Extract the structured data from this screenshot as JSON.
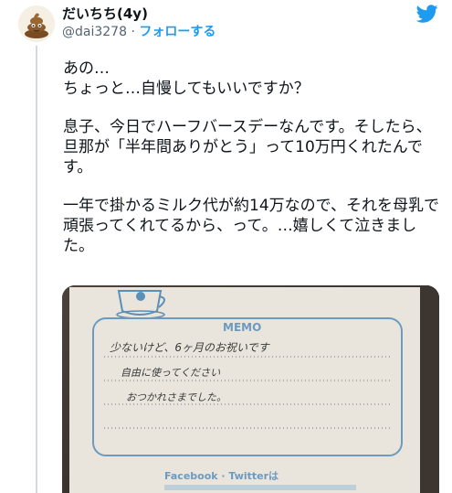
{
  "author": {
    "name": "だいちち(4y)",
    "handle": "@dai3278",
    "separator": "·",
    "follow_label": "フォローする"
  },
  "icons": {
    "avatar": "poop-emoji-avatar",
    "brand": "twitter-bird-icon"
  },
  "colors": {
    "accent": "#1d9bf0",
    "text": "#0f1419",
    "secondary": "#536471"
  },
  "tweet": {
    "paragraphs": [
      "あの…\nちょっと…自慢してもいいですか？",
      "息子、今日でハーフバースデーなんです。そしたら、旦那が「半年間ありがとう」って10万円くれたんです。",
      "一年で掛かるミルク代が約14万なので、それを母乳で頑張ってくれてるから、って。…嬉しくて泣きました。"
    ]
  },
  "photo": {
    "memo_title": "MEMO",
    "handwritten_lines": [
      "少ないけど、6ヶ月のお祝いです",
      "自由に使ってください",
      "おつかれさまでした。"
    ],
    "footer": "Facebook · Twitterは"
  }
}
